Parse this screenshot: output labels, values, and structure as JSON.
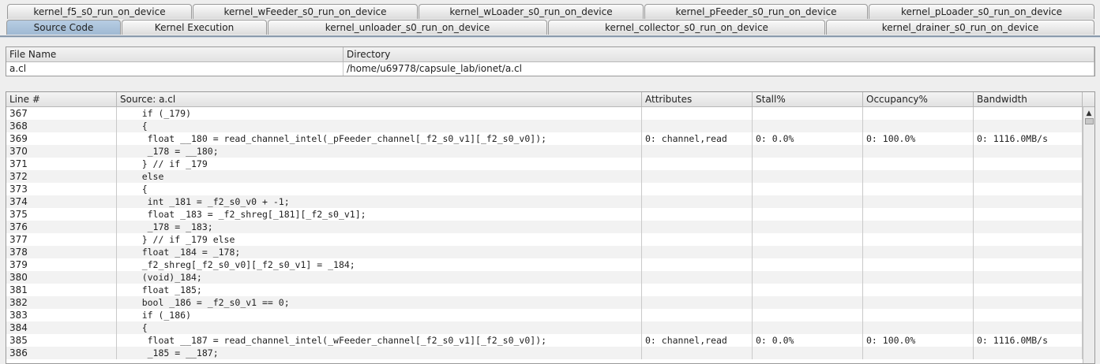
{
  "tabs_row1": [
    "kernel_f5_s0_run_on_device",
    "kernel_wFeeder_s0_run_on_device",
    "kernel_wLoader_s0_run_on_device",
    "kernel_pFeeder_s0_run_on_device",
    "kernel_pLoader_s0_run_on_device"
  ],
  "tabs_row2": [
    "Source Code",
    "Kernel Execution",
    "kernel_unloader_s0_run_on_device",
    "kernel_collector_s0_run_on_device",
    "kernel_drainer_s0_run_on_device"
  ],
  "selected_tab": "Source Code",
  "file_table": {
    "headers": [
      "File Name",
      "Directory"
    ],
    "row": [
      "a.cl",
      "/home/u69778/capsule_lab/ionet/a.cl"
    ]
  },
  "source_table": {
    "headers": [
      "Line #",
      "Source: a.cl",
      "Attributes",
      "Stall%",
      "Occupancy%",
      "Bandwidth"
    ],
    "rows": [
      [
        "367",
        "    if (_179)",
        "",
        "",
        "",
        ""
      ],
      [
        "368",
        "    {",
        "",
        "",
        "",
        ""
      ],
      [
        "369",
        "     float __180 = read_channel_intel(_pFeeder_channel[_f2_s0_v1][_f2_s0_v0]);",
        "0: channel,read",
        "0: 0.0%",
        "0: 100.0%",
        "0: 1116.0MB/s"
      ],
      [
        "370",
        "     _178 = __180;",
        "",
        "",
        "",
        ""
      ],
      [
        "371",
        "    } // if _179",
        "",
        "",
        "",
        ""
      ],
      [
        "372",
        "    else",
        "",
        "",
        "",
        ""
      ],
      [
        "373",
        "    {",
        "",
        "",
        "",
        ""
      ],
      [
        "374",
        "     int _181 = _f2_s0_v0 + -1;",
        "",
        "",
        "",
        ""
      ],
      [
        "375",
        "     float _183 = _f2_shreg[_181][_f2_s0_v1];",
        "",
        "",
        "",
        ""
      ],
      [
        "376",
        "     _178 = _183;",
        "",
        "",
        "",
        ""
      ],
      [
        "377",
        "    } // if _179 else",
        "",
        "",
        "",
        ""
      ],
      [
        "378",
        "    float _184 = _178;",
        "",
        "",
        "",
        ""
      ],
      [
        "379",
        "    _f2_shreg[_f2_s0_v0][_f2_s0_v1] = _184;",
        "",
        "",
        "",
        ""
      ],
      [
        "380",
        "    (void)_184;",
        "",
        "",
        "",
        ""
      ],
      [
        "381",
        "    float _185;",
        "",
        "",
        "",
        ""
      ],
      [
        "382",
        "    bool _186 = _f2_s0_v1 == 0;",
        "",
        "",
        "",
        ""
      ],
      [
        "383",
        "    if (_186)",
        "",
        "",
        "",
        ""
      ],
      [
        "384",
        "    {",
        "",
        "",
        "",
        ""
      ],
      [
        "385",
        "     float __187 = read_channel_intel(_wFeeder_channel[_f2_s0_v1][_f2_s0_v0]);",
        "0: channel,read",
        "0: 0.0%",
        "0: 100.0%",
        "0: 1116.0MB/s"
      ],
      [
        "386",
        "     _185 = __187;",
        "",
        "",
        "",
        ""
      ]
    ]
  }
}
